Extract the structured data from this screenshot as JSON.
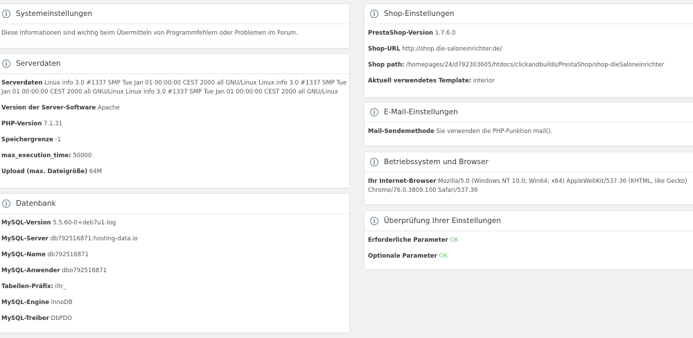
{
  "system": {
    "title": "Systemeinstellungen",
    "description": "Diese Informationen sind wichtig beim Übermitteln von Programmfehlern oder Problemen im Forum."
  },
  "server": {
    "title": "Serverdaten",
    "rows": [
      {
        "label": "Serverdaten",
        "value": "Linux info 3.0 #1337 SMP Tue Jan 01 00:00:00 CEST 2000 all GNU/Linux Linux info 3.0 #1337 SMP Tue Jan 01 00:00:00 CEST 2000 all GNU/Linux Linux info 3.0 #1337 SMP Tue Jan 01 00:00:00 CEST 2000 all GNU/Linux"
      },
      {
        "label": "Version der Server-Software",
        "value": "Apache"
      },
      {
        "label": "PHP-Version",
        "value": "7.1.31"
      },
      {
        "label": "Speichergrenze",
        "value": "-1"
      },
      {
        "label": "max_execution_time:",
        "value": "50000"
      },
      {
        "label": "Upload (max. Dateigröße)",
        "value": "64M"
      }
    ]
  },
  "database": {
    "title": "Datenbank",
    "rows": [
      {
        "label": "MySQL-Version",
        "value": "5.5.60-0+deb7u1-log"
      },
      {
        "label": "MySQL-Server",
        "value": "db792516871.hosting-data.io"
      },
      {
        "label": "MySQL-Name",
        "value": "db792516871"
      },
      {
        "label": "MySQL-Anwender",
        "value": "dbo792516871"
      },
      {
        "label": "Tabellen-Präfix:",
        "value": "iltr_"
      },
      {
        "label": "MySQL-Engine",
        "value": "InnoDB"
      },
      {
        "label": "MySQL-Treiber",
        "value": "DbPDO"
      }
    ]
  },
  "shop": {
    "title": "Shop-Einstellungen",
    "rows": [
      {
        "label": "PrestaShop-Version",
        "value": "1.7.6.0"
      },
      {
        "label": "Shop-URL",
        "value": "http://shop.die-saloneinrichter.de/"
      },
      {
        "label": "Shop path:",
        "value": "/homepages/24/d792303605/htdocs/clickandbuilds/PrestaShop/shop-dieSaloneinrichter"
      },
      {
        "label": "Aktuell verwendetes Template:",
        "value": "interior"
      }
    ]
  },
  "mail": {
    "title": "E-Mail-Einstellungen",
    "rows": [
      {
        "label": "Mail-Sendemethode",
        "value": "Sie verwenden die PHP-Funktion mail()."
      }
    ]
  },
  "os": {
    "title": "Betriebssystem und Browser",
    "rows": [
      {
        "label": "Ihr Internet-Browser",
        "value": "Mozilla/5.0 (Windows NT 10.0; Win64; x64) AppleWebKit/537.36 (KHTML, like Gecko) Chrome/76.0.3809.100 Safari/537.36"
      }
    ]
  },
  "check": {
    "title": "Überprüfung Ihrer Einstellungen",
    "rows": [
      {
        "label": "Erforderliche Parameter",
        "value": "OK"
      },
      {
        "label": "Optionale Parameter",
        "value": "OK"
      }
    ]
  },
  "colors": {
    "ok": "#72c279",
    "background": "#eff1f2",
    "heading": "#363a41"
  },
  "icons": {
    "panel_heading": "info-circle-icon"
  }
}
